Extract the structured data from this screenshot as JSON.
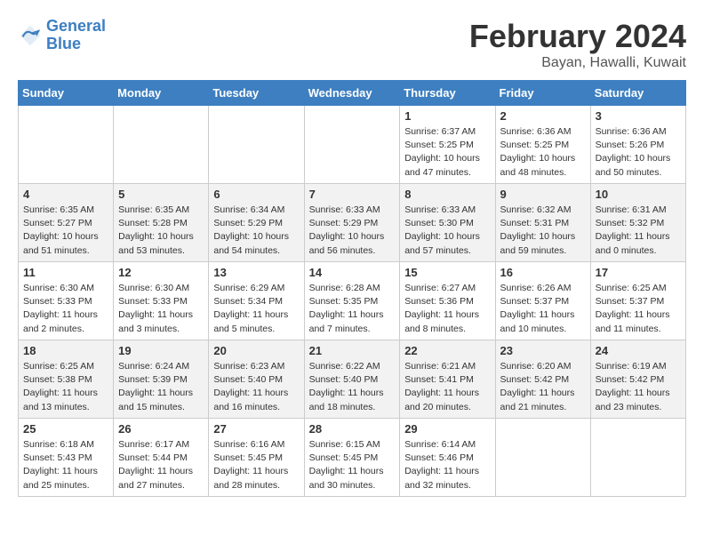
{
  "header": {
    "logo_line1": "General",
    "logo_line2": "Blue",
    "month": "February 2024",
    "location": "Bayan, Hawalli, Kuwait"
  },
  "weekdays": [
    "Sunday",
    "Monday",
    "Tuesday",
    "Wednesday",
    "Thursday",
    "Friday",
    "Saturday"
  ],
  "weeks": [
    [
      {
        "day": "",
        "info": ""
      },
      {
        "day": "",
        "info": ""
      },
      {
        "day": "",
        "info": ""
      },
      {
        "day": "",
        "info": ""
      },
      {
        "day": "1",
        "info": "Sunrise: 6:37 AM\nSunset: 5:25 PM\nDaylight: 10 hours\nand 47 minutes."
      },
      {
        "day": "2",
        "info": "Sunrise: 6:36 AM\nSunset: 5:25 PM\nDaylight: 10 hours\nand 48 minutes."
      },
      {
        "day": "3",
        "info": "Sunrise: 6:36 AM\nSunset: 5:26 PM\nDaylight: 10 hours\nand 50 minutes."
      }
    ],
    [
      {
        "day": "4",
        "info": "Sunrise: 6:35 AM\nSunset: 5:27 PM\nDaylight: 10 hours\nand 51 minutes."
      },
      {
        "day": "5",
        "info": "Sunrise: 6:35 AM\nSunset: 5:28 PM\nDaylight: 10 hours\nand 53 minutes."
      },
      {
        "day": "6",
        "info": "Sunrise: 6:34 AM\nSunset: 5:29 PM\nDaylight: 10 hours\nand 54 minutes."
      },
      {
        "day": "7",
        "info": "Sunrise: 6:33 AM\nSunset: 5:29 PM\nDaylight: 10 hours\nand 56 minutes."
      },
      {
        "day": "8",
        "info": "Sunrise: 6:33 AM\nSunset: 5:30 PM\nDaylight: 10 hours\nand 57 minutes."
      },
      {
        "day": "9",
        "info": "Sunrise: 6:32 AM\nSunset: 5:31 PM\nDaylight: 10 hours\nand 59 minutes."
      },
      {
        "day": "10",
        "info": "Sunrise: 6:31 AM\nSunset: 5:32 PM\nDaylight: 11 hours\nand 0 minutes."
      }
    ],
    [
      {
        "day": "11",
        "info": "Sunrise: 6:30 AM\nSunset: 5:33 PM\nDaylight: 11 hours\nand 2 minutes."
      },
      {
        "day": "12",
        "info": "Sunrise: 6:30 AM\nSunset: 5:33 PM\nDaylight: 11 hours\nand 3 minutes."
      },
      {
        "day": "13",
        "info": "Sunrise: 6:29 AM\nSunset: 5:34 PM\nDaylight: 11 hours\nand 5 minutes."
      },
      {
        "day": "14",
        "info": "Sunrise: 6:28 AM\nSunset: 5:35 PM\nDaylight: 11 hours\nand 7 minutes."
      },
      {
        "day": "15",
        "info": "Sunrise: 6:27 AM\nSunset: 5:36 PM\nDaylight: 11 hours\nand 8 minutes."
      },
      {
        "day": "16",
        "info": "Sunrise: 6:26 AM\nSunset: 5:37 PM\nDaylight: 11 hours\nand 10 minutes."
      },
      {
        "day": "17",
        "info": "Sunrise: 6:25 AM\nSunset: 5:37 PM\nDaylight: 11 hours\nand 11 minutes."
      }
    ],
    [
      {
        "day": "18",
        "info": "Sunrise: 6:25 AM\nSunset: 5:38 PM\nDaylight: 11 hours\nand 13 minutes."
      },
      {
        "day": "19",
        "info": "Sunrise: 6:24 AM\nSunset: 5:39 PM\nDaylight: 11 hours\nand 15 minutes."
      },
      {
        "day": "20",
        "info": "Sunrise: 6:23 AM\nSunset: 5:40 PM\nDaylight: 11 hours\nand 16 minutes."
      },
      {
        "day": "21",
        "info": "Sunrise: 6:22 AM\nSunset: 5:40 PM\nDaylight: 11 hours\nand 18 minutes."
      },
      {
        "day": "22",
        "info": "Sunrise: 6:21 AM\nSunset: 5:41 PM\nDaylight: 11 hours\nand 20 minutes."
      },
      {
        "day": "23",
        "info": "Sunrise: 6:20 AM\nSunset: 5:42 PM\nDaylight: 11 hours\nand 21 minutes."
      },
      {
        "day": "24",
        "info": "Sunrise: 6:19 AM\nSunset: 5:42 PM\nDaylight: 11 hours\nand 23 minutes."
      }
    ],
    [
      {
        "day": "25",
        "info": "Sunrise: 6:18 AM\nSunset: 5:43 PM\nDaylight: 11 hours\nand 25 minutes."
      },
      {
        "day": "26",
        "info": "Sunrise: 6:17 AM\nSunset: 5:44 PM\nDaylight: 11 hours\nand 27 minutes."
      },
      {
        "day": "27",
        "info": "Sunrise: 6:16 AM\nSunset: 5:45 PM\nDaylight: 11 hours\nand 28 minutes."
      },
      {
        "day": "28",
        "info": "Sunrise: 6:15 AM\nSunset: 5:45 PM\nDaylight: 11 hours\nand 30 minutes."
      },
      {
        "day": "29",
        "info": "Sunrise: 6:14 AM\nSunset: 5:46 PM\nDaylight: 11 hours\nand 32 minutes."
      },
      {
        "day": "",
        "info": ""
      },
      {
        "day": "",
        "info": ""
      }
    ]
  ]
}
